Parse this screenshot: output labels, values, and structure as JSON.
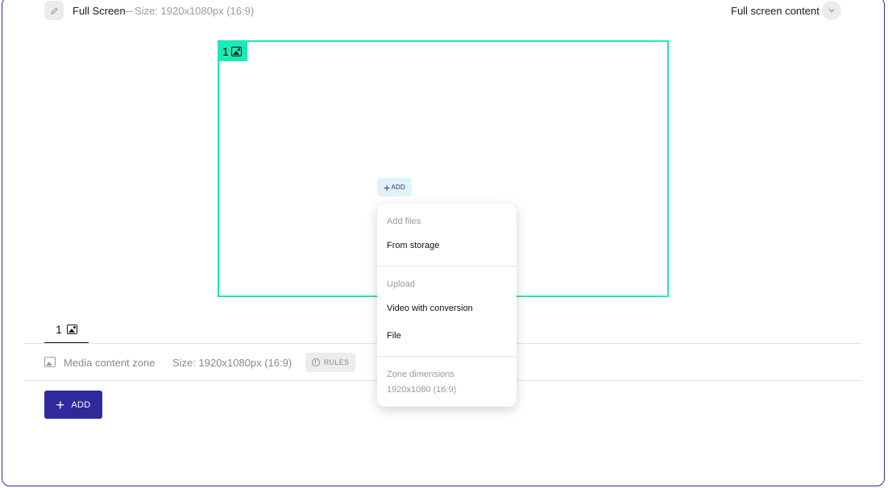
{
  "header": {
    "title": "Full Screen",
    "separator": "—",
    "size": "Size: 1920x1080px (16:9)",
    "content_label": "Full screen content",
    "edit_icon": "pencil-icon",
    "chevron_icon": "chevron-down-icon"
  },
  "zone": {
    "tag_number": "1",
    "tag_icon": "image-icon",
    "accent_color": "#1de9b6",
    "add_label": "ADD"
  },
  "menu": {
    "section_add_files": "Add files",
    "from_storage": "From storage",
    "section_upload": "Upload",
    "video_with_conversion": "Video with conversion",
    "file": "File",
    "section_dimensions": "Zone dimensions",
    "dimensions_value": "1920x1080 (16:9)"
  },
  "tabs": [
    {
      "label": "1",
      "icon": "image-icon"
    }
  ],
  "content_row": {
    "icon": "image-icon",
    "label": "Media content zone",
    "size": "Size: 1920x1080px (16:9)",
    "rules_label": "RULES",
    "rules_icon": "timer-icon"
  },
  "add_button": {
    "label": "ADD",
    "color": "#2e2a9c"
  }
}
